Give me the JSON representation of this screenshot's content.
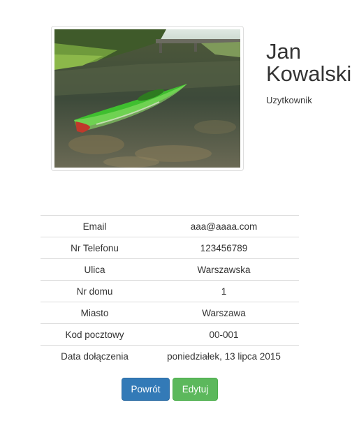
{
  "profile": {
    "first_name": "Jan",
    "last_name": "Kowalski",
    "role": "Uzytkownik",
    "photo_icon": "kayak-photo"
  },
  "details": [
    {
      "label": "Email",
      "value": "aaa@aaaa.com"
    },
    {
      "label": "Nr Telefonu",
      "value": "123456789"
    },
    {
      "label": "Ulica",
      "value": "Warszawska"
    },
    {
      "label": "Nr domu",
      "value": "1"
    },
    {
      "label": "Miasto",
      "value": "Warszawa"
    },
    {
      "label": "Kod pocztowy",
      "value": "00-001"
    },
    {
      "label": "Data dołączenia",
      "value": "poniedziałek, 13 lipca 2015"
    }
  ],
  "actions": {
    "back_label": "Powrót",
    "edit_label": "Edytuj"
  },
  "colors": {
    "primary": "#337ab7",
    "success": "#5cb85c"
  }
}
